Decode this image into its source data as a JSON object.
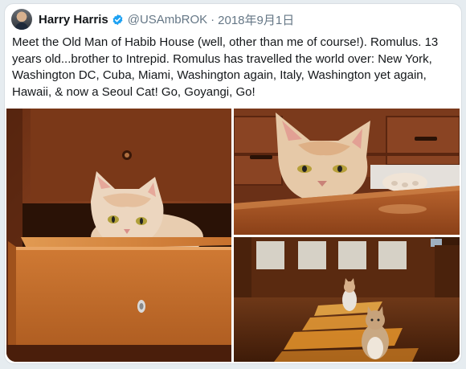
{
  "tweet": {
    "author": {
      "name": "Harry Harris",
      "handle": "@USAmbROK",
      "verified": true,
      "avatar_icon": "profile-photo"
    },
    "separator": "·",
    "date": "2018年9月1日",
    "text": "Meet the Old Man of Habib House (well, other than me of course!). Romulus. 13 years old...brother to Intrepid. Romulus has travelled the world over:  New York, Washington DC, Cuba, Miami, Washington again, Italy, Washington yet again, Hawaii, & now a Seoul Cat!  Go, Goyangi, Go!",
    "media": [
      {
        "subject": "cat peeking out of an open wooden drawer"
      },
      {
        "subject": "cat peering over the edge of a wooden table"
      },
      {
        "subject": "two cats sitting on a sunlit wooden floor in a hallway"
      }
    ]
  },
  "colors": {
    "text": "#14171a",
    "secondary": "#657786",
    "verified_badge": "#1da1f2",
    "border": "#d8dee3"
  }
}
